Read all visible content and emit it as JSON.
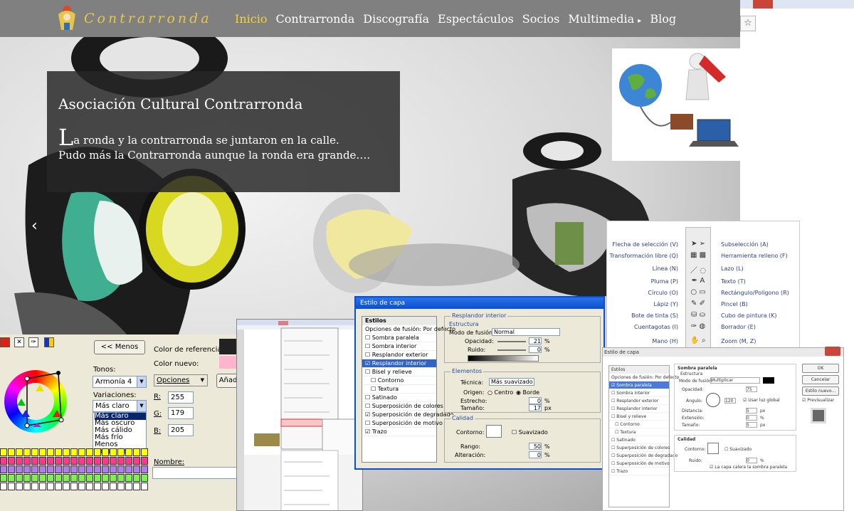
{
  "brand": {
    "name": "Contrarronda"
  },
  "nav": {
    "items": [
      "Inicio",
      "Contrarronda",
      "Discografía",
      "Espectáculos",
      "Socios",
      "Multimedia",
      "Blog"
    ],
    "submenu_marker": "▸"
  },
  "caption": {
    "title": "Asociación Cultural Contrarronda",
    "dropcap": "L",
    "line1": "a ronda y la contrarronda se juntaron en la calle.",
    "line2": "Pudo más la Contrarronda aunque la ronda era grande…."
  },
  "carousel": {
    "prev_arrow": "‹"
  },
  "browser": {
    "star": "☆"
  },
  "tools_panel": {
    "left_items": [
      "Flecha de selección (V)",
      "Transformación libre (Q)",
      "Línea (N)",
      "Pluma (P)",
      "Círculo (O)",
      "Lápiz (Y)",
      "Bote de tinta (S)",
      "Cuentagotas (I)",
      "Mano (H)"
    ],
    "right_items": [
      "Subselección (A)",
      "Herramienta relleno (F)",
      "Lazo (L)",
      "Texto (T)",
      "Rectángulo/Polígono (R)",
      "Pincel (B)",
      "Cubo de pintura (K)",
      "Borrador (E)",
      "Zoom (M, Z)"
    ]
  },
  "color_picker": {
    "less_button": "<< Menos",
    "tones_label": "Tonos:",
    "tones_value": "Armonía 4",
    "variations_label": "Variaciones:",
    "variations": [
      "Más claro",
      "Más claro",
      "Más oscuro",
      "Más cálido",
      "Más frío",
      "Menos saturado"
    ],
    "ref_color_label": "Color de referencia:",
    "new_color_label": "Color nuevo:",
    "options_button": "Opciones",
    "add_button": "Añadir",
    "r_label": "R:",
    "r_value": "255",
    "g_label": "G:",
    "g_value": "179",
    "b_label": "B:",
    "b_value": "205",
    "name_label": "Nombre:"
  },
  "layer_style": {
    "title": "Estilo de capa",
    "list_header": "Estilos",
    "items": [
      "Opciones de fusión: Por defecto",
      "Sombra paralela",
      "Sombra interior",
      "Resplandor exterior",
      "Resplandor interior",
      "Bisel y relieve",
      "Contorno",
      "Textura",
      "Satinado",
      "Superposición de colores",
      "Superposición de degradado",
      "Superposición de motivo",
      "Trazo"
    ],
    "selected_index": 4,
    "group1_title": "Resplandor interior",
    "group1_sub": "Estructura",
    "blend_mode_label": "Modo de fusión:",
    "blend_mode_value": "Normal",
    "opacity_label": "Opacidad:",
    "opacity_value": "21",
    "opacity_unit": "%",
    "noise_label": "Ruido:",
    "noise_value": "0",
    "noise_unit": "%",
    "elements_title": "Elementos",
    "technique_label": "Técnica:",
    "technique_value": "Más suavizado",
    "source_label": "Origen:",
    "source_center": "Centro",
    "source_edge": "Borde",
    "choke_label": "Estrecho:",
    "choke_value": "0",
    "choke_unit": "%",
    "size_label": "Tamaño:",
    "size_value": "17",
    "size_unit": "px",
    "quality_title": "Calidad",
    "contour_label": "Contorno:",
    "smooth_label": "Suavizado",
    "range_label": "Rango:",
    "range_value": "50",
    "range_unit": "%",
    "jitter_label": "Alteración:",
    "jitter_value": "0",
    "jitter_unit": "%"
  },
  "layer_style2": {
    "title": "Estilo de capa",
    "list_header": "Estilos",
    "items": [
      "Opciones de fusión: Por defecto",
      "Sombra paralela",
      "Sombra interior",
      "Resplandor exterior",
      "Resplandor interior",
      "Bisel y relieve",
      "Contorno",
      "Textura",
      "Satinado",
      "Superposición de colores",
      "Superposición de degradado",
      "Superposición de motivo",
      "Trazo"
    ],
    "selected_index": 1,
    "group_title": "Sombra paralela",
    "group_sub": "Estructura",
    "blend_mode_label": "Modo de fusión:",
    "blend_mode_value": "Multiplicar",
    "opacity_label": "Opacidad:",
    "opacity_value": "75",
    "angle_label": "Ángulo:",
    "angle_value": "120",
    "global_light_label": "Usar luz global",
    "distance_label": "Distancia:",
    "distance_value": "5",
    "distance_unit": "px",
    "spread_label": "Extensión:",
    "spread_value": "0",
    "spread_unit": "%",
    "size_label": "Tamaño:",
    "size_value": "5",
    "size_unit": "px",
    "quality_title": "Calidad",
    "contour_label": "Contorno:",
    "smooth_label": "Suavizado",
    "noise_label": "Ruido:",
    "noise_value": "0",
    "noise_unit": "%",
    "knockout_label": "La capa calera la sombra paralela",
    "ok_button": "OK",
    "cancel_button": "Cancelar",
    "new_style_button": "Estilo nuevo...",
    "preview_label": "Previsualizar"
  },
  "colors": {
    "navbar": "#808080",
    "accent": "#f5d23a",
    "logo": "#e6c64a",
    "caption_bg": "#262626",
    "xp_blue": "#0a4fd0"
  }
}
